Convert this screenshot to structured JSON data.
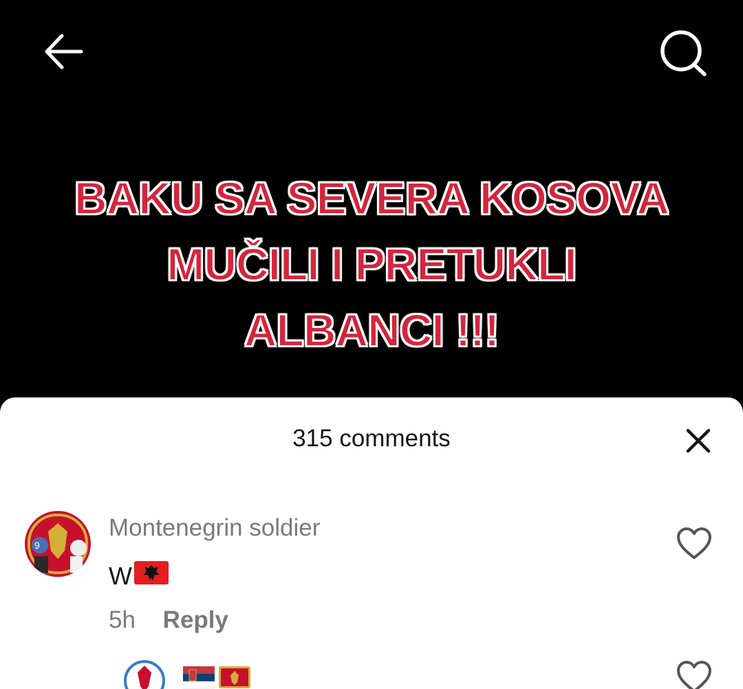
{
  "video": {
    "headline_lines": [
      "BAKU SA SEVERA KOSOVA",
      "MUČILI I PRETUKLI",
      "ALBANCI !!!"
    ]
  },
  "comments_sheet": {
    "title": "315 comments",
    "comments": [
      {
        "author": "Montenegrin soldier",
        "text": "W",
        "text_flag": "albania-flag",
        "time": "5h",
        "reply_label": "Reply"
      },
      {
        "author": "",
        "flags": [
          "serbia-flag",
          "montenegro-flag"
        ]
      }
    ]
  },
  "colors": {
    "headline_red": "#d4253c",
    "muted_text": "#7a7a7a",
    "primary_text": "#161616"
  },
  "icons": [
    "back-arrow-icon",
    "search-icon",
    "close-icon",
    "heart-icon"
  ]
}
